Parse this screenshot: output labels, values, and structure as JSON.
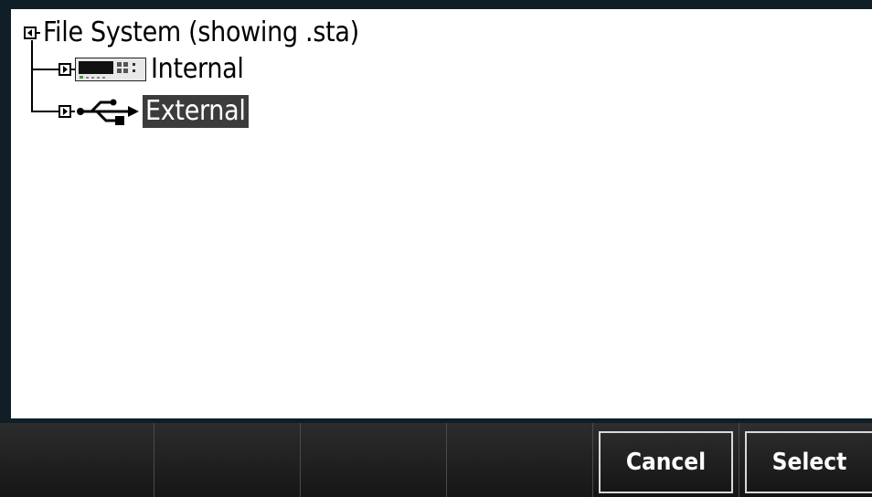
{
  "tree": {
    "root": {
      "label": "File System (showing .sta)",
      "state": "expanded"
    },
    "children": [
      {
        "label": "Internal",
        "icon": "instrument-icon",
        "state": "collapsed",
        "selected": false
      },
      {
        "label": "External",
        "icon": "usb-icon",
        "state": "collapsed",
        "selected": true
      }
    ]
  },
  "softkeys": {
    "key1": "",
    "key2": "",
    "key3": "",
    "key4": "",
    "cancel": "Cancel",
    "select": "Select"
  },
  "colors": {
    "background": "#0f1e27",
    "panel": "#ffffff",
    "selection": "#3c3c3c",
    "softkey": "#1f1f1f",
    "softkey_text": "#ffffff"
  }
}
